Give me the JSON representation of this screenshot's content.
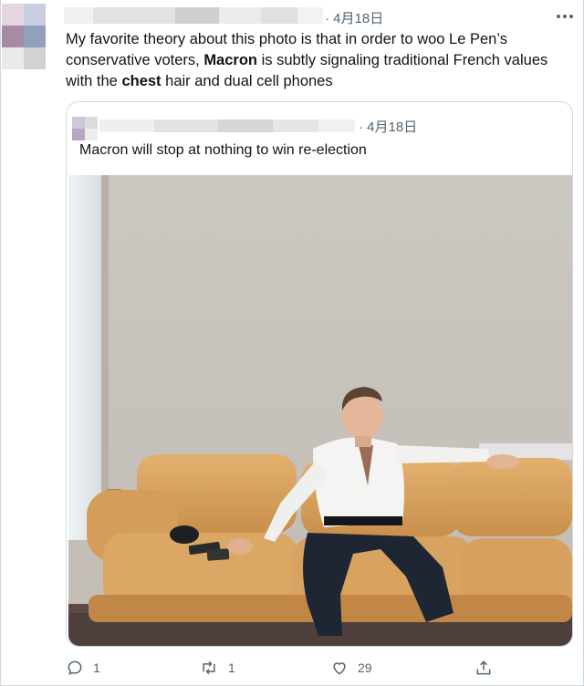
{
  "tweet": {
    "date": "· 4月18日",
    "text": {
      "part1": "My favorite theory about this photo is that in order to woo Le Pen’s conservative voters, ",
      "bold1": "Macron",
      "part2": " is subtly signaling traditional French values with the ",
      "bold2": "chest",
      "part3": " hair and dual cell phones"
    },
    "icons": {
      "more": "more-horizontal-icon"
    }
  },
  "quoted_tweet": {
    "date": "· 4月18日",
    "text": "Macron will stop at nothing to win re-election",
    "image": {
      "kind": "photo",
      "subject": "man in white shirt seated on tan leather sofa against a beige wall"
    }
  },
  "actions": {
    "reply": {
      "icon": "reply-icon",
      "count": "1"
    },
    "retweet": {
      "icon": "retweet-icon",
      "count": "1"
    },
    "like": {
      "icon": "heart-icon",
      "count": "29"
    },
    "share": {
      "icon": "share-icon"
    }
  },
  "colors": {
    "text": "#0f1419",
    "secondary": "#536471",
    "border": "#cfd9de",
    "sofa": "#d9a35e",
    "wall": "#c8c3bc"
  }
}
